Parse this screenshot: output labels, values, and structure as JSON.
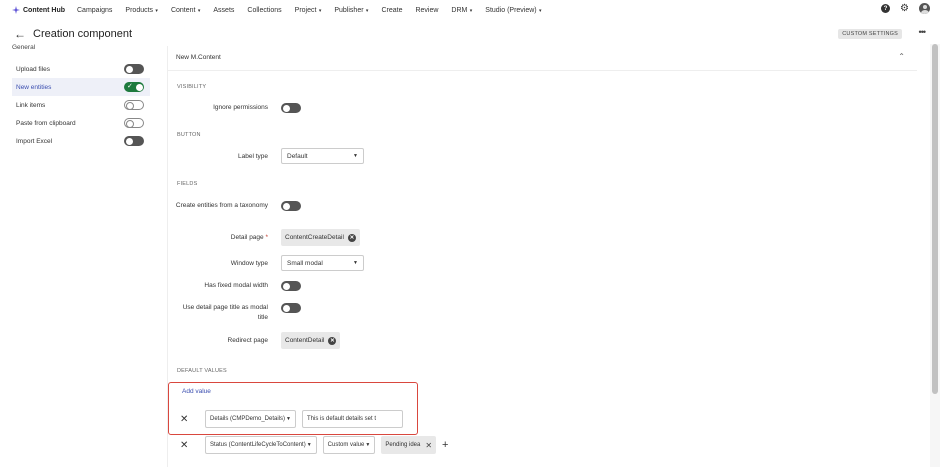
{
  "nav": {
    "brand": "Content Hub",
    "items": [
      {
        "label": "Campaigns",
        "caret": false
      },
      {
        "label": "Products",
        "caret": true
      },
      {
        "label": "Content",
        "caret": true
      },
      {
        "label": "Assets",
        "caret": false
      },
      {
        "label": "Collections",
        "caret": false
      },
      {
        "label": "Project",
        "caret": true
      },
      {
        "label": "Publisher",
        "caret": true
      },
      {
        "label": "Create",
        "caret": false
      },
      {
        "label": "Review",
        "caret": false
      },
      {
        "label": "DRM",
        "caret": true
      },
      {
        "label": "Studio (Preview)",
        "caret": true
      }
    ],
    "help_glyph": "?",
    "gear_glyph": "⚙"
  },
  "header": {
    "back_glyph": "←",
    "title": "Creation component",
    "custom_settings": "CUSTOM SETTINGS",
    "more_glyph": "•••"
  },
  "sidebar": {
    "heading": "General",
    "items": [
      {
        "label": "Upload files",
        "state": "off"
      },
      {
        "label": "New entities",
        "state": "on"
      },
      {
        "label": "Link items",
        "state": "outline"
      },
      {
        "label": "Paste from clipboard",
        "state": "outline"
      },
      {
        "label": "Import Excel",
        "state": "off"
      }
    ]
  },
  "main": {
    "entity_title": "New M.Content",
    "chevron": "⌃",
    "sections": {
      "visibility": "VISIBILITY",
      "button": "BUTTON",
      "fields": "FIELDS",
      "default_values": "DEFAULT VALUES"
    },
    "fields": {
      "ignore_permissions": "Ignore permissions",
      "label_type": "Label type",
      "label_type_value": "Default",
      "create_from_taxonomy": "Create entities from a taxonomy",
      "detail_page": "Detail page",
      "required_mark": "*",
      "detail_page_value": "ContentCreateDetail",
      "window_type": "Window type",
      "window_type_value": "Small modal",
      "fixed_modal_width": "Has fixed modal width",
      "use_detail_title": "Use detail page title as modal title",
      "redirect_page": "Redirect page",
      "redirect_page_value": "ContentDetail"
    },
    "default_values": {
      "add_value": "Add value",
      "row1": {
        "field": "Details (CMPDemo_Details)",
        "value": "This is default details set t"
      },
      "row2": {
        "field": "Status (ContentLifeCycleToContent)",
        "mode": "Custom value",
        "chip": "Pending idea"
      }
    }
  },
  "colors": {
    "accent": "#3b4eb0",
    "toggle_on": "#1e7a3e",
    "highlight": "#d9473e"
  }
}
